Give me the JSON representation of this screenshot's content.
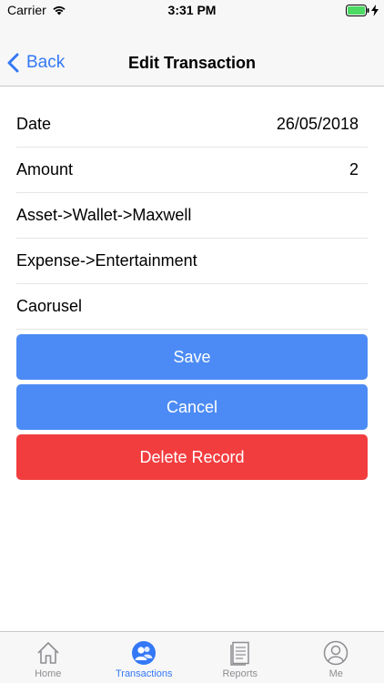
{
  "status_bar": {
    "carrier": "Carrier",
    "time": "3:31 PM"
  },
  "nav": {
    "back_label": "Back",
    "title": "Edit Transaction"
  },
  "form": {
    "date_label": "Date",
    "date_value": "26/05/2018",
    "amount_label": "Amount",
    "amount_value": "2",
    "from_account": "Asset->Wallet->Maxwell",
    "to_account": "Expense->Entertainment",
    "description": "Caorusel"
  },
  "buttons": {
    "save": "Save",
    "cancel": "Cancel",
    "delete": "Delete Record"
  },
  "tabs": [
    {
      "label": "Home",
      "icon": "home-icon",
      "active": false
    },
    {
      "label": "Transactions",
      "icon": "people-icon",
      "active": true
    },
    {
      "label": "Reports",
      "icon": "document-icon",
      "active": false
    },
    {
      "label": "Me",
      "icon": "person-icon",
      "active": false
    }
  ],
  "colors": {
    "accent": "#3478f6",
    "button_blue": "#4c8bf5",
    "button_red": "#f23d3f",
    "battery": "#4cd964"
  }
}
